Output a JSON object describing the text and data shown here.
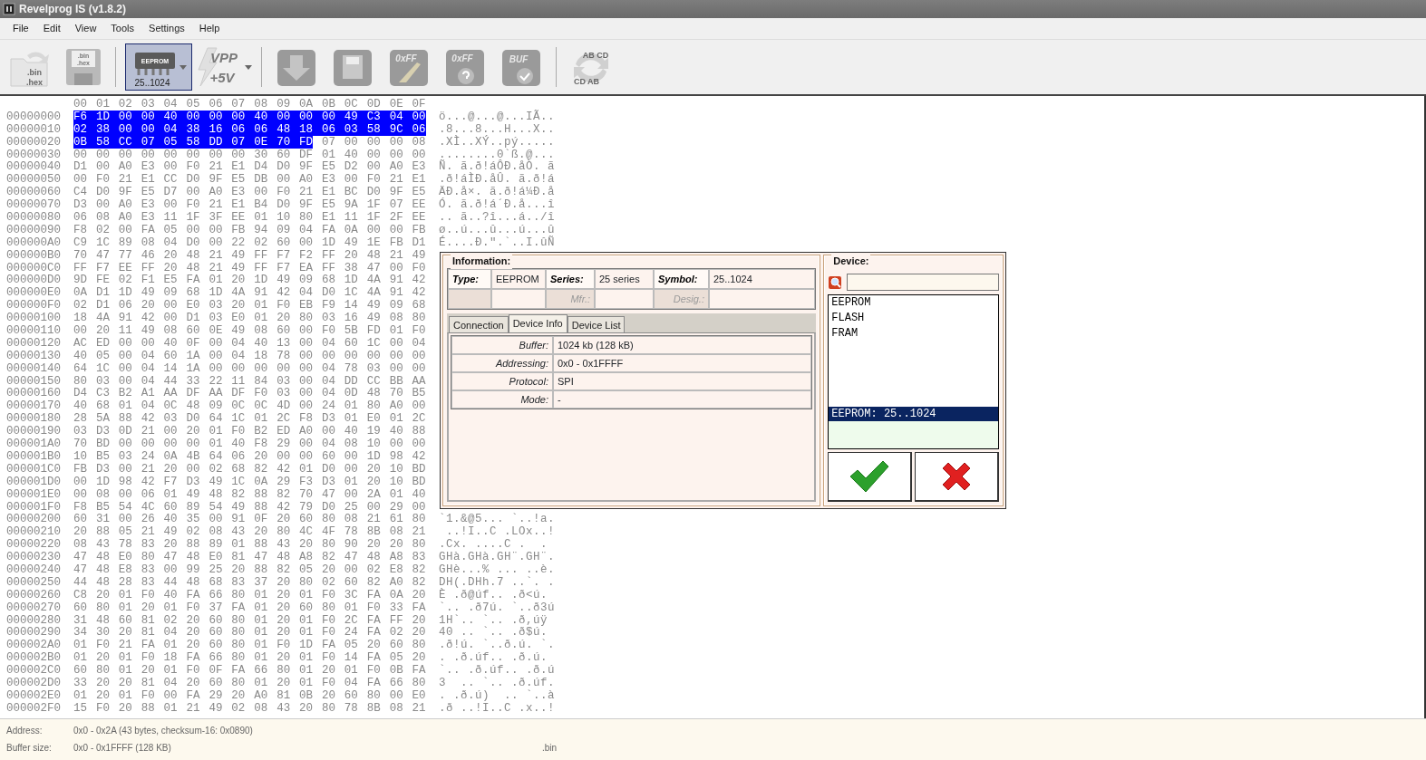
{
  "window": {
    "title": "Revelprog IS (v1.8.2)"
  },
  "menu": [
    "File",
    "Edit",
    "View",
    "Tools",
    "Settings",
    "Help"
  ],
  "toolbar": [
    {
      "kind": "open",
      "texts": [
        ".bin",
        ".hex"
      ],
      "pressed": false
    },
    {
      "kind": "save",
      "texts": [
        ".bin",
        ".hex"
      ],
      "pressed": false
    },
    {
      "kind": "separator"
    },
    {
      "kind": "chip",
      "texts": [
        "EEPROM"
      ],
      "label": "25..1024",
      "pressed": true
    },
    {
      "kind": "vpp",
      "texts": [
        "VPP",
        "+5V"
      ],
      "pressed": false
    },
    {
      "kind": "separator"
    },
    {
      "kind": "read",
      "pressed": false
    },
    {
      "kind": "write",
      "pressed": false
    },
    {
      "kind": "erase",
      "texts": [
        "0xFF"
      ],
      "pressed": false
    },
    {
      "kind": "blank",
      "texts": [
        "0xFF"
      ],
      "pressed": false
    },
    {
      "kind": "verify",
      "texts": [
        "BUF"
      ],
      "pressed": false
    },
    {
      "kind": "separator"
    },
    {
      "kind": "swap",
      "texts": [
        "AB CD",
        "CD AB"
      ],
      "pressed": false
    }
  ],
  "hex_view": {
    "header": "00 01 02 03 04 05 06 07 08 09 0A 0B 0C 0D 0E 0F",
    "rows": [
      {
        "address": "00000000",
        "selected_bytes": "F6 1D 00 00 40 00 00 00 40 00 00 00 49 C3 04 00",
        "ascii": "ö...@...@...IÃ.."
      },
      {
        "address": "00000010",
        "selected_bytes": "02 38 00 00 04 38 16 06 06 48 18 06 03 58 9C 06",
        "ascii": ".8...8...H...X.."
      },
      {
        "address": "00000020",
        "selected_bytes": "0B 58 CC 07 05 58 DD 07 0E 70 FD",
        "bytes": "07 00 00 00 08",
        "ascii": ".XÌ..XÝ..pý....."
      },
      {
        "address": "00000030",
        "bytes": "00 00 00 00 00 00 00 00 30 60 DF 01 40 00 00 00",
        "ascii": "........0`ß.@..."
      },
      {
        "address": "00000040",
        "bytes": "D1 00 A0 E3 00 F0 21 E1 D4 D0 9F E5 D2 00 A0 E3",
        "ascii": "Ñ. ã.ð!áÔÐ.åÒ. ã"
      },
      {
        "address": "00000050",
        "bytes": "00 F0 21 E1 CC D0 9F E5 DB 00 A0 E3 00 F0 21 E1",
        "ascii": ".ð!áÌÐ.åÛ. ã.ð!á"
      },
      {
        "address": "00000060",
        "bytes": "C4 D0 9F E5 D7 00 A0 E3 00 F0 21 E1 BC D0 9F E5",
        "ascii": "ÄÐ.å×. ã.ð!á¼Ð.å"
      },
      {
        "address": "00000070",
        "bytes": "D3 00 A0 E3 00 F0 21 E1 B4 D0 9F E5 9A 1F 07 EE",
        "ascii": "Ó. ã.ð!á´Ð.å...î"
      },
      {
        "address": "00000080",
        "bytes": "06 08 A0 E3 11 1F 3F EE 01 10 80 E1 11 1F 2F EE",
        "ascii": ".. ã..?î...á../î"
      },
      {
        "address": "00000090",
        "bytes": "F8 02 00 FA 05 00 00 FB 94 09 04 FA 0A 00 00 FB",
        "ascii": "ø..ú...û...ú...û"
      },
      {
        "address": "000000A0",
        "bytes": "C9 1C 89 08 04 D0 00 22 02 60 00 1D 49 1E FB D1",
        "ascii": "É....Ð.\".`..I.ûÑ"
      },
      {
        "address": "000000B0",
        "bytes": "70 47 77 46 20 48 21 49 FF F7 F2 FF 20 48 21 49"
      },
      {
        "address": "000000C0",
        "bytes": "FF F7 EE FF 20 48 21 49 FF F7 EA FF 38 47 00 F0"
      },
      {
        "address": "000000D0",
        "bytes": "9D FE 02 F1 E5 FA 01 20 1D 49 09 68 1D 4A 91 42"
      },
      {
        "address": "000000E0",
        "bytes": "0A D1 1D 49 09 68 1D 4A 91 42 04 D0 1C 4A 91 42"
      },
      {
        "address": "000000F0",
        "bytes": "02 D1 06 20 00 E0 03 20 01 F0 EB F9 14 49 09 68"
      },
      {
        "address": "00000100",
        "bytes": "18 4A 91 42 00 D1 03 E0 01 20 80 03 16 49 08 80"
      },
      {
        "address": "00000110",
        "bytes": "00 20 11 49 08 60 0E 49 08 60 00 F0 5B FD 01 F0"
      },
      {
        "address": "00000120",
        "bytes": "AC ED 00 00 40 0F 00 04 40 13 00 04 60 1C 00 04"
      },
      {
        "address": "00000130",
        "bytes": "40 05 00 04 60 1A 00 04 18 78 00 00 00 00 00 00"
      },
      {
        "address": "00000140",
        "bytes": "64 1C 00 04 14 1A 00 00 00 00 00 04 78 03 00 00"
      },
      {
        "address": "00000150",
        "bytes": "80 03 00 04 44 33 22 11 84 03 00 04 DD CC BB AA"
      },
      {
        "address": "00000160",
        "bytes": "D4 C3 B2 A1 AA DF AA DF F0 03 00 04 0D 48 70 B5"
      },
      {
        "address": "00000170",
        "bytes": "40 68 01 04 0C 48 09 0C 0C 4D 00 24 01 80 A0 00"
      },
      {
        "address": "00000180",
        "bytes": "28 5A 88 42 03 D0 64 1C 01 2C F8 D3 01 E0 01 2C"
      },
      {
        "address": "00000190",
        "bytes": "03 D3 0D 21 00 20 01 F0 B2 ED A0 00 40 19 40 88"
      },
      {
        "address": "000001A0",
        "bytes": "70 BD 00 00 00 00 01 40 F8 29 00 04 08 10 00 00"
      },
      {
        "address": "000001B0",
        "bytes": "10 B5 03 24 0A 4B 64 06 20 00 00 60 00 1D 98 42"
      },
      {
        "address": "000001C0",
        "bytes": "FB D3 00 21 20 00 02 68 82 42 01 D0 00 20 10 BD"
      },
      {
        "address": "000001D0",
        "bytes": "00 1D 98 42 F7 D3 49 1C 0A 29 F3 D3 01 20 10 BD"
      },
      {
        "address": "000001E0",
        "bytes": "00 08 00 06 01 49 48 82 88 82 70 47 00 2A 01 40"
      },
      {
        "address": "000001F0",
        "bytes": "F8 B5 54 4C 60 89 54 49 88 42 79 D0 25 00 29 00"
      },
      {
        "address": "00000200",
        "bytes": "60 31 00 26 40 35 00 91 0F 20 60 80 08 21 61 80",
        "ascii": "`1.&@5... `..!a."
      },
      {
        "address": "00000210",
        "bytes": "20 88 05 21 49 02 08 43 20 80 4C 4F 78 8B 08 21",
        "ascii": " ..!I..C .LOx..!"
      },
      {
        "address": "00000220",
        "bytes": "08 43 78 83 20 88 89 01 88 43 20 80 90 20 20 80",
        "ascii": ".Cx. ....C .  ."
      },
      {
        "address": "00000230",
        "bytes": "47 48 E0 80 47 48 E0 81 47 48 A8 82 47 48 A8 83",
        "ascii": "GHà.GHà.GH¨.GH¨."
      },
      {
        "address": "00000240",
        "bytes": "47 48 E8 83 00 99 25 20 88 82 05 20 00 02 E8 82",
        "ascii": "GHè...% ... ..è."
      },
      {
        "address": "00000250",
        "bytes": "44 48 28 83 44 48 68 83 37 20 80 02 60 82 A0 82",
        "ascii": "DH(.DHh.7 ..`. ."
      },
      {
        "address": "00000260",
        "bytes": "C8 20 01 F0 40 FA 66 80 01 20 01 F0 3C FA 0A 20",
        "ascii": "È .ð@úf.. .ð<ú."
      },
      {
        "address": "00000270",
        "bytes": "60 80 01 20 01 F0 37 FA 01 20 60 80 01 F0 33 FA",
        "ascii": "`.. .ð7ú. `..ð3ú"
      },
      {
        "address": "00000280",
        "bytes": "31 48 60 81 02 20 60 80 01 20 01 F0 2C FA FF 20",
        "ascii": "1H`.. `.. .ð,úÿ"
      },
      {
        "address": "00000290",
        "bytes": "34 30 20 81 04 20 60 80 01 20 01 F0 24 FA 02 20",
        "ascii": "40 .. `.. .ð$ú."
      },
      {
        "address": "000002A0",
        "bytes": "01 F0 21 FA 01 20 60 80 01 F0 1D FA 05 20 60 80",
        "ascii": ".ð!ú. `..ð.ú. `."
      },
      {
        "address": "000002B0",
        "bytes": "01 20 01 F0 18 FA 66 80 01 20 01 F0 14 FA 05 20",
        "ascii": ". .ð.úf.. .ð.ú."
      },
      {
        "address": "000002C0",
        "bytes": "60 80 01 20 01 F0 0F FA 66 80 01 20 01 F0 0B FA",
        "ascii": "`.. .ð.úf.. .ð.ú"
      },
      {
        "address": "000002D0",
        "bytes": "33 20 20 81 04 20 60 80 01 20 01 F0 04 FA 66 80",
        "ascii": "3  .. `.. .ð.úf."
      },
      {
        "address": "000002E0",
        "bytes": "01 20 01 F0 00 FA 29 20 A0 81 0B 20 60 80 00 E0",
        "ascii": ". .ð.ú)  .. `..à"
      },
      {
        "address": "000002F0",
        "bytes": "15 F0 20 88 01 21 49 02 08 43 20 80 78 8B 08 21",
        "ascii": ".ð ..!I..C .x..!"
      }
    ]
  },
  "device_dialog": {
    "information": {
      "title": "Information:",
      "grid": [
        [
          {
            "label": "Type:",
            "value": "EEPROM",
            "disabled": false
          },
          {
            "label": "Series:",
            "value": "25 series",
            "disabled": false
          },
          {
            "label": "Symbol:",
            "value": "25..1024",
            "disabled": false
          }
        ],
        [
          {
            "disabled": true
          },
          {
            "label": "Mfr.:",
            "disabled": true
          },
          {
            "label": "Desig.:",
            "disabled": true
          }
        ]
      ],
      "tabs": [
        {
          "label": "Connection",
          "selected": false
        },
        {
          "label": "Device Info",
          "selected": true
        },
        {
          "label": "Device List",
          "selected": false
        }
      ],
      "details": [
        {
          "label": "Buffer:",
          "value": "1024 kb (128 kB)"
        },
        {
          "label": "Addressing:",
          "value": "0x0 - 0x1FFFF"
        },
        {
          "label": "Protocol:",
          "value": "SPI"
        },
        {
          "label": "Mode:",
          "value": "-"
        }
      ]
    },
    "device": {
      "title": "Device:",
      "categories": [
        "EEPROM",
        "FLASH",
        "FRAM"
      ],
      "selection": "EEPROM: 25..1024",
      "buttons": [
        {
          "kind": "ok"
        },
        {
          "kind": "cancel"
        }
      ]
    }
  },
  "status_bar": [
    {
      "label": "Address:",
      "value": "0x0 - 0x2A (43 bytes, checksum-16: 0x0890)"
    },
    {
      "label": "Buffer size:",
      "value": "0x0 - 0x1FFFF (128 KB)",
      "file": ".bin"
    }
  ]
}
